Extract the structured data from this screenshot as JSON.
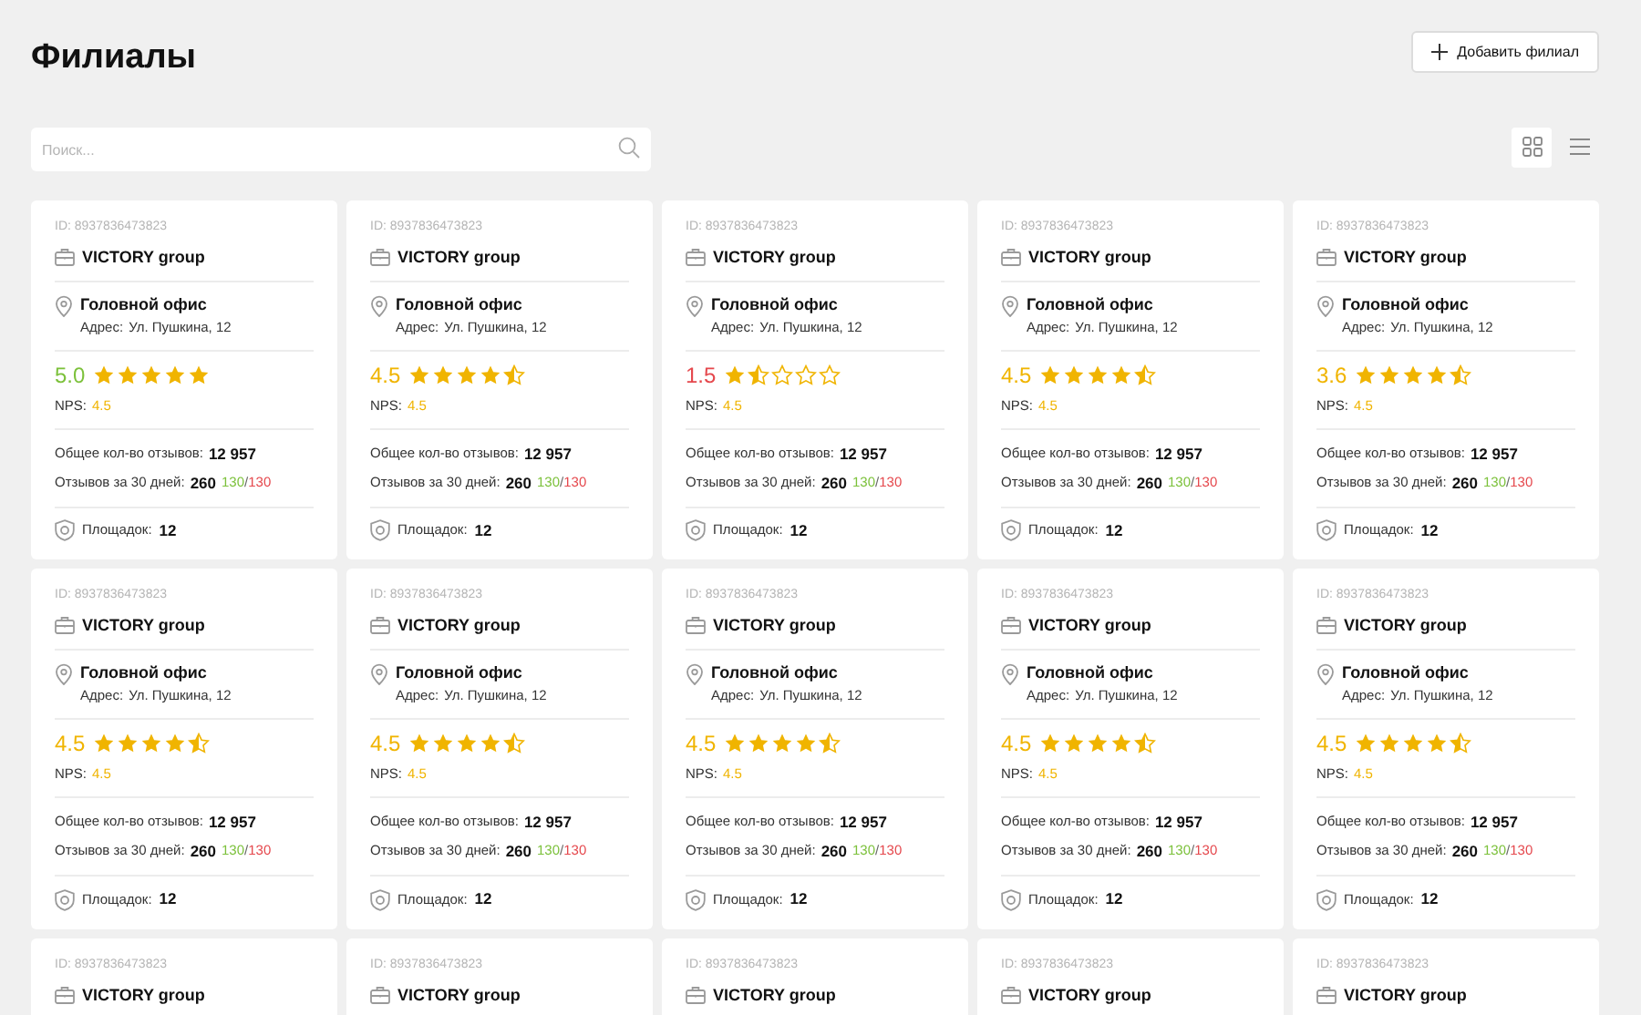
{
  "title": "Филиалы",
  "add_button": {
    "label": "Добавить филиал"
  },
  "search": {
    "placeholder": "Поиск..."
  },
  "view_toggle": [
    {
      "kind": "grid",
      "selected": true
    },
    {
      "kind": "list",
      "selected": false
    }
  ],
  "branches": [
    {
      "id": "ID: 8937836473823",
      "company": "VICTORY group",
      "office": "Головной офис",
      "address_label": "Адрес:",
      "address": "Ул. Пушкина, 12",
      "score": "5.0",
      "color": "#7cc13b",
      "stars": 5,
      "nps_label": "NPS:",
      "nps": "4.5",
      "total_label": "Общее кол-во отзывов:",
      "total": "12 957",
      "month_label": "Отзывов за 30 дней:",
      "month": "260",
      "positive": "130",
      "separator": "/",
      "negative": "130",
      "platforms_label": "Площадок:",
      "platforms": "12"
    },
    {
      "id": "ID: 8937836473823",
      "company": "VICTORY group",
      "office": "Головной офис",
      "address_label": "Адрес:",
      "address": "Ул. Пушкина, 12",
      "score": "4.5",
      "color": "#f0b400",
      "stars": 4.5,
      "nps_label": "NPS:",
      "nps": "4.5",
      "total_label": "Общее кол-во отзывов:",
      "total": "12 957",
      "month_label": "Отзывов за 30 дней:",
      "month": "260",
      "positive": "130",
      "separator": "/",
      "negative": "130",
      "platforms_label": "Площадок:",
      "platforms": "12"
    },
    {
      "id": "ID: 8937836473823",
      "company": "VICTORY group",
      "office": "Головной офис",
      "address_label": "Адрес:",
      "address": "Ул. Пушкина, 12",
      "score": "1.5",
      "color": "#e5484d",
      "stars": 1.5,
      "nps_label": "NPS:",
      "nps": "4.5",
      "total_label": "Общее кол-во отзывов:",
      "total": "12 957",
      "month_label": "Отзывов за 30 дней:",
      "month": "260",
      "positive": "130",
      "separator": "/",
      "negative": "130",
      "platforms_label": "Площадок:",
      "platforms": "12"
    },
    {
      "id": "ID: 8937836473823",
      "company": "VICTORY group",
      "office": "Головной офис",
      "address_label": "Адрес:",
      "address": "Ул. Пушкина, 12",
      "score": "4.5",
      "color": "#f0b400",
      "stars": 4.5,
      "nps_label": "NPS:",
      "nps": "4.5",
      "total_label": "Общее кол-во отзывов:",
      "total": "12 957",
      "month_label": "Отзывов за 30 дней:",
      "month": "260",
      "positive": "130",
      "separator": "/",
      "negative": "130",
      "platforms_label": "Площадок:",
      "platforms": "12"
    },
    {
      "id": "ID: 8937836473823",
      "company": "VICTORY group",
      "office": "Головной офис",
      "address_label": "Адрес:",
      "address": "Ул. Пушкина, 12",
      "score": "3.6",
      "color": "#f0b400",
      "stars": 4.5,
      "nps_label": "NPS:",
      "nps": "4.5",
      "total_label": "Общее кол-во отзывов:",
      "total": "12 957",
      "month_label": "Отзывов за 30 дней:",
      "month": "260",
      "positive": "130",
      "separator": "/",
      "negative": "130",
      "platforms_label": "Площадок:",
      "platforms": "12"
    },
    {
      "id": "ID: 8937836473823",
      "company": "VICTORY group",
      "office": "Головной офис",
      "address_label": "Адрес:",
      "address": "Ул. Пушкина, 12",
      "score": "4.5",
      "color": "#f0b400",
      "stars": 4.5,
      "nps_label": "NPS:",
      "nps": "4.5",
      "total_label": "Общее кол-во отзывов:",
      "total": "12 957",
      "month_label": "Отзывов за 30 дней:",
      "month": "260",
      "positive": "130",
      "separator": "/",
      "negative": "130",
      "platforms_label": "Площадок:",
      "platforms": "12"
    },
    {
      "id": "ID: 8937836473823",
      "company": "VICTORY group",
      "office": "Головной офис",
      "address_label": "Адрес:",
      "address": "Ул. Пушкина, 12",
      "score": "4.5",
      "color": "#f0b400",
      "stars": 4.5,
      "nps_label": "NPS:",
      "nps": "4.5",
      "total_label": "Общее кол-во отзывов:",
      "total": "12 957",
      "month_label": "Отзывов за 30 дней:",
      "month": "260",
      "positive": "130",
      "separator": "/",
      "negative": "130",
      "platforms_label": "Площадок:",
      "platforms": "12"
    },
    {
      "id": "ID: 8937836473823",
      "company": "VICTORY group",
      "office": "Головной офис",
      "address_label": "Адрес:",
      "address": "Ул. Пушкина, 12",
      "score": "4.5",
      "color": "#f0b400",
      "stars": 4.5,
      "nps_label": "NPS:",
      "nps": "4.5",
      "total_label": "Общее кол-во отзывов:",
      "total": "12 957",
      "month_label": "Отзывов за 30 дней:",
      "month": "260",
      "positive": "130",
      "separator": "/",
      "negative": "130",
      "platforms_label": "Площадок:",
      "platforms": "12"
    },
    {
      "id": "ID: 8937836473823",
      "company": "VICTORY group",
      "office": "Головной офис",
      "address_label": "Адрес:",
      "address": "Ул. Пушкина, 12",
      "score": "4.5",
      "color": "#f0b400",
      "stars": 4.5,
      "nps_label": "NPS:",
      "nps": "4.5",
      "total_label": "Общее кол-во отзывов:",
      "total": "12 957",
      "month_label": "Отзывов за 30 дней:",
      "month": "260",
      "positive": "130",
      "separator": "/",
      "negative": "130",
      "platforms_label": "Площадок:",
      "platforms": "12"
    },
    {
      "id": "ID: 8937836473823",
      "company": "VICTORY group",
      "office": "Головной офис",
      "address_label": "Адрес:",
      "address": "Ул. Пушкина, 12",
      "score": "4.5",
      "color": "#f0b400",
      "stars": 4.5,
      "nps_label": "NPS:",
      "nps": "4.5",
      "total_label": "Общее кол-во отзывов:",
      "total": "12 957",
      "month_label": "Отзывов за 30 дней:",
      "month": "260",
      "positive": "130",
      "separator": "/",
      "negative": "130",
      "platforms_label": "Площадок:",
      "platforms": "12"
    },
    {
      "id": "ID: 8937836473823",
      "company": "VICTORY group"
    },
    {
      "id": "ID: 8937836473823",
      "company": "VICTORY group"
    },
    {
      "id": "ID: 8937836473823",
      "company": "VICTORY group"
    },
    {
      "id": "ID: 8937836473823",
      "company": "VICTORY group"
    },
    {
      "id": "ID: 8937836473823",
      "company": "VICTORY group"
    }
  ]
}
